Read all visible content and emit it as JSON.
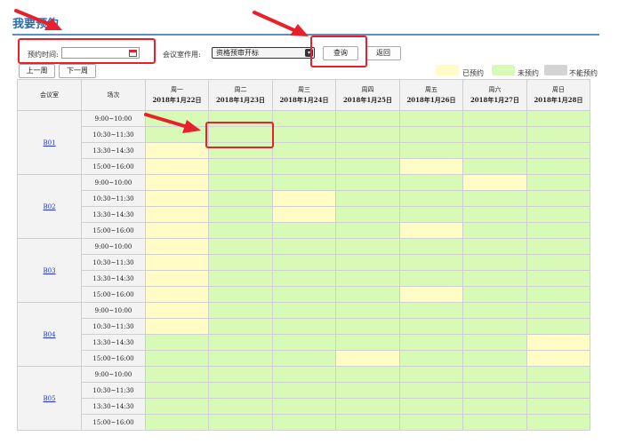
{
  "page": {
    "title": "我要预约"
  },
  "controls": {
    "date_label": "预约时间:",
    "date_value": "",
    "purpose_label": "会议室作用:",
    "purpose_selected": "资格预审开标",
    "query_button": "查询",
    "back_button": "返回",
    "prev_week_button": "上一周",
    "next_week_button": "下一周"
  },
  "legend": [
    {
      "label": "已预约",
      "color": "#fffcc6"
    },
    {
      "label": "未预约",
      "color": "#d7fbb6"
    },
    {
      "label": "不能预约",
      "color": "#d4d4d4"
    }
  ],
  "table": {
    "room_header": "会议室",
    "slot_header": "场次",
    "days": [
      {
        "weekday": "周一",
        "date": "2018年1月22日"
      },
      {
        "weekday": "周二",
        "date": "2018年1月23日"
      },
      {
        "weekday": "周三",
        "date": "2018年1月24日"
      },
      {
        "weekday": "周四",
        "date": "2018年1月25日"
      },
      {
        "weekday": "周五",
        "date": "2018年1月26日"
      },
      {
        "weekday": "周六",
        "date": "2018年1月27日"
      },
      {
        "weekday": "周日",
        "date": "2018年1月28日"
      }
    ],
    "slots": [
      "9:00~10:00",
      "10:30~11:30",
      "13:30~14:30",
      "15:00~16:00"
    ],
    "rooms": [
      {
        "name": "B01",
        "status": [
          [
            "f",
            "f",
            "f",
            "f",
            "f",
            "f",
            "f"
          ],
          [
            "f",
            "f",
            "f",
            "f",
            "f",
            "f",
            "f"
          ],
          [
            "b",
            "f",
            "f",
            "f",
            "f",
            "f",
            "f"
          ],
          [
            "b",
            "f",
            "f",
            "f",
            "b",
            "f",
            "f"
          ]
        ]
      },
      {
        "name": "B02",
        "status": [
          [
            "b",
            "f",
            "f",
            "f",
            "f",
            "b",
            "f"
          ],
          [
            "b",
            "f",
            "b",
            "f",
            "f",
            "f",
            "f"
          ],
          [
            "b",
            "f",
            "b",
            "f",
            "f",
            "f",
            "f"
          ],
          [
            "b",
            "f",
            "f",
            "f",
            "b",
            "f",
            "f"
          ]
        ]
      },
      {
        "name": "B03",
        "status": [
          [
            "b",
            "f",
            "f",
            "f",
            "f",
            "f",
            "f"
          ],
          [
            "b",
            "f",
            "f",
            "f",
            "f",
            "f",
            "f"
          ],
          [
            "b",
            "f",
            "f",
            "f",
            "f",
            "f",
            "f"
          ],
          [
            "b",
            "f",
            "f",
            "f",
            "b",
            "f",
            "f"
          ]
        ]
      },
      {
        "name": "B04",
        "status": [
          [
            "b",
            "f",
            "f",
            "f",
            "f",
            "f",
            "f"
          ],
          [
            "b",
            "f",
            "f",
            "f",
            "f",
            "f",
            "f"
          ],
          [
            "f",
            "f",
            "f",
            "f",
            "f",
            "f",
            "b"
          ],
          [
            "f",
            "f",
            "f",
            "b",
            "f",
            "f",
            "b"
          ]
        ]
      },
      {
        "name": "B05",
        "status": [
          [
            "f",
            "f",
            "f",
            "f",
            "f",
            "f",
            "f"
          ],
          [
            "f",
            "f",
            "f",
            "f",
            "f",
            "f",
            "f"
          ],
          [
            "f",
            "f",
            "f",
            "f",
            "f",
            "f",
            "f"
          ],
          [
            "f",
            "f",
            "f",
            "f",
            "f",
            "f",
            "f"
          ]
        ]
      }
    ]
  }
}
